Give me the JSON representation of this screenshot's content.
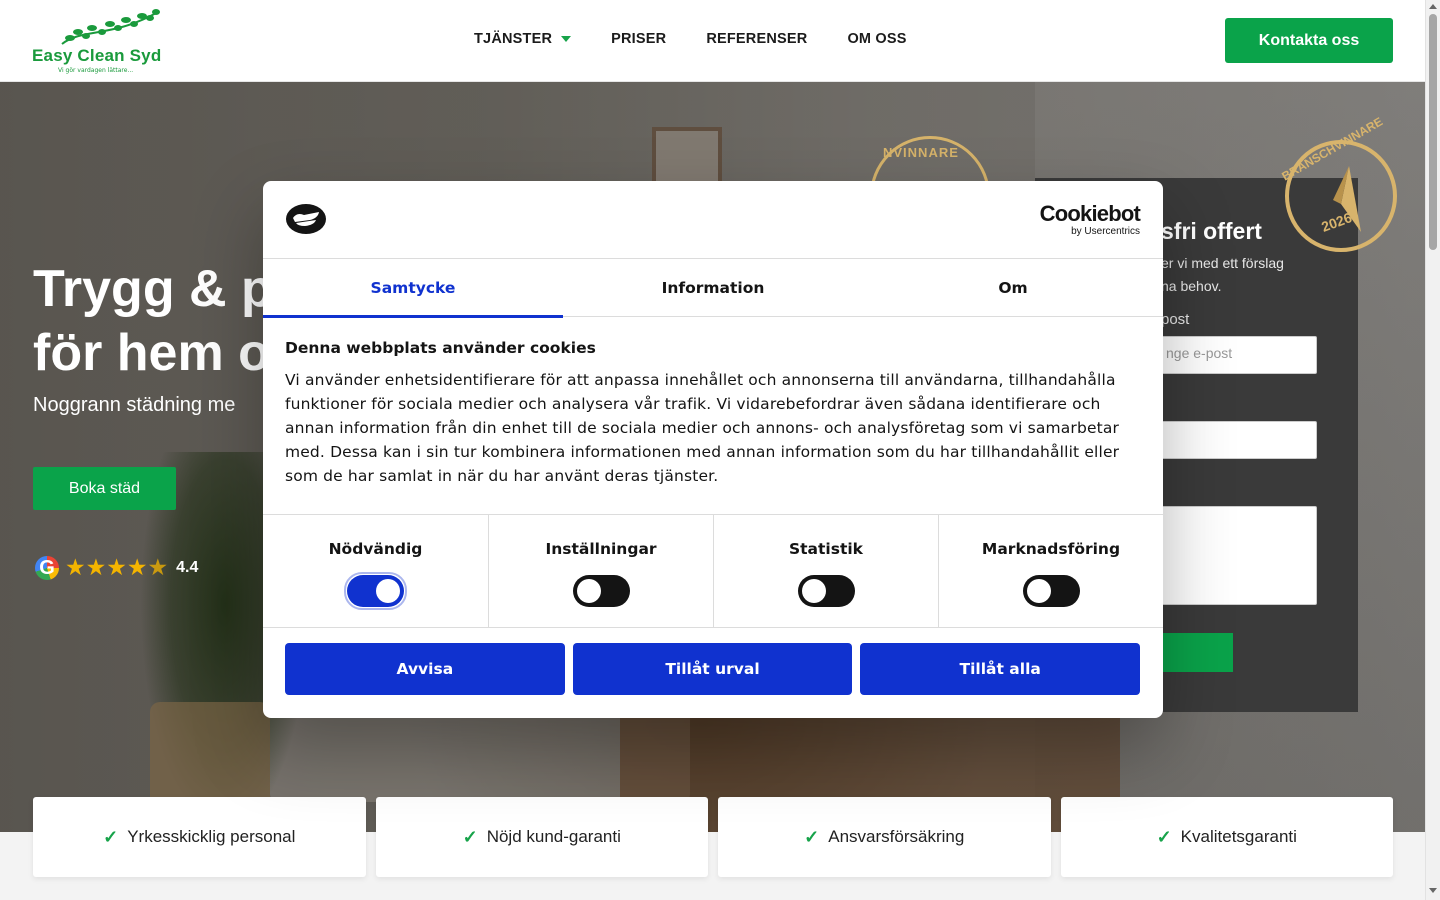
{
  "header": {
    "logo_text": "Easy Clean Syd",
    "logo_tagline": "Vi gör vardagen lättare...",
    "nav": [
      {
        "label": "TJÄNSTER",
        "dropdown": true
      },
      {
        "label": "PRISER"
      },
      {
        "label": "REFERENSER"
      },
      {
        "label": "OM OSS"
      }
    ],
    "contact_button": "Kontakta oss",
    "accent_color": "#0aa34a"
  },
  "hero": {
    "title_line1": "Trygg & p",
    "title_line2": "för hem o",
    "subtitle": "Noggrann städning me",
    "book_button": "Boka städ",
    "rating_value": "4.4",
    "rating_stars": 4.4,
    "badge_text": "NVINNARE"
  },
  "quote_form": {
    "title": "sfri offert",
    "text": "er vi med ett förslag\nna behov.",
    "email_label": "post",
    "email_placeholder": "nge e-post"
  },
  "badge": {
    "text": "BRANSCHVINNARE",
    "year": "2026"
  },
  "features": [
    "Yrkesskicklig personal",
    "Nöjd kund-garanti",
    "Ansvarsförsäkring",
    "Kvalitetsgaranti"
  ],
  "cookie_dialog": {
    "brand_name": "Cookiebot",
    "brand_by": "by Usercentrics",
    "tabs": [
      "Samtycke",
      "Information",
      "Om"
    ],
    "active_tab": "Samtycke",
    "heading": "Denna webbplats använder cookies",
    "body": "Vi använder enhetsidentifierare för att anpassa innehållet och annonserna till användarna, tillhandahålla funktioner för sociala medier och analysera vår trafik. Vi vidarebefordrar även sådana identifierare och annan information från din enhet till de sociala medier och annons- och analysföretag som vi samarbetar med. Dessa kan i sin tur kombinera informationen med annan information som du har tillhandahållit eller som de har samlat in när du har använt deras tjänster.",
    "toggles": [
      {
        "label": "Nödvändig",
        "on": true
      },
      {
        "label": "Inställningar",
        "on": false
      },
      {
        "label": "Statistik",
        "on": false
      },
      {
        "label": "Marknadsföring",
        "on": false
      }
    ],
    "buttons": [
      "Avvisa",
      "Tillåt urval",
      "Tillåt alla"
    ],
    "primary_color": "#1032cf"
  }
}
